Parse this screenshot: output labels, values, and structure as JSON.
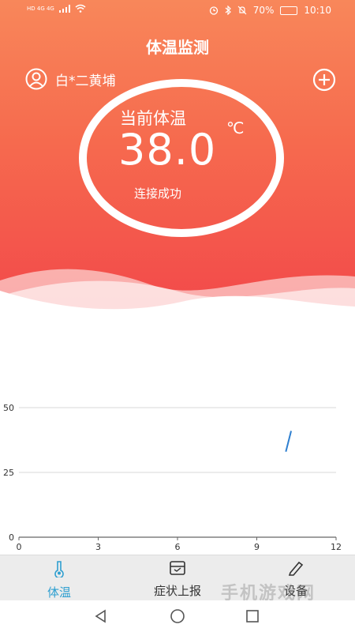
{
  "status_bar": {
    "left_text": "HD 4G 4G",
    "battery": "70%",
    "time": "10:10"
  },
  "header": {
    "title": "体温监测",
    "user_name": "白*二黄埔"
  },
  "gauge": {
    "label": "当前体温",
    "value": "38.0",
    "unit": "℃",
    "status": "连接成功"
  },
  "chart_data": {
    "type": "line",
    "x_ticks": [
      "0",
      "3",
      "6",
      "9",
      "12"
    ],
    "y_ticks": [
      "0",
      "25",
      "50"
    ],
    "xlim": [
      0,
      12
    ],
    "ylim": [
      0,
      50
    ],
    "grid": true,
    "series": [
      {
        "x": [
          10.1,
          10.3
        ],
        "y": [
          33,
          41
        ],
        "color": "#2e7fd0"
      }
    ]
  },
  "tabs": [
    {
      "label": "体温",
      "icon": "thermometer-icon",
      "active": true
    },
    {
      "label": "症状上报",
      "icon": "report-inbox-icon",
      "active": false
    },
    {
      "label": "设备",
      "icon": "device-pen-icon",
      "active": false
    }
  ],
  "colors": {
    "accent": "#2e9fd0",
    "hero_top": "#f8875a",
    "hero_bottom": "#f2484a"
  },
  "watermark": "手机游戏网"
}
